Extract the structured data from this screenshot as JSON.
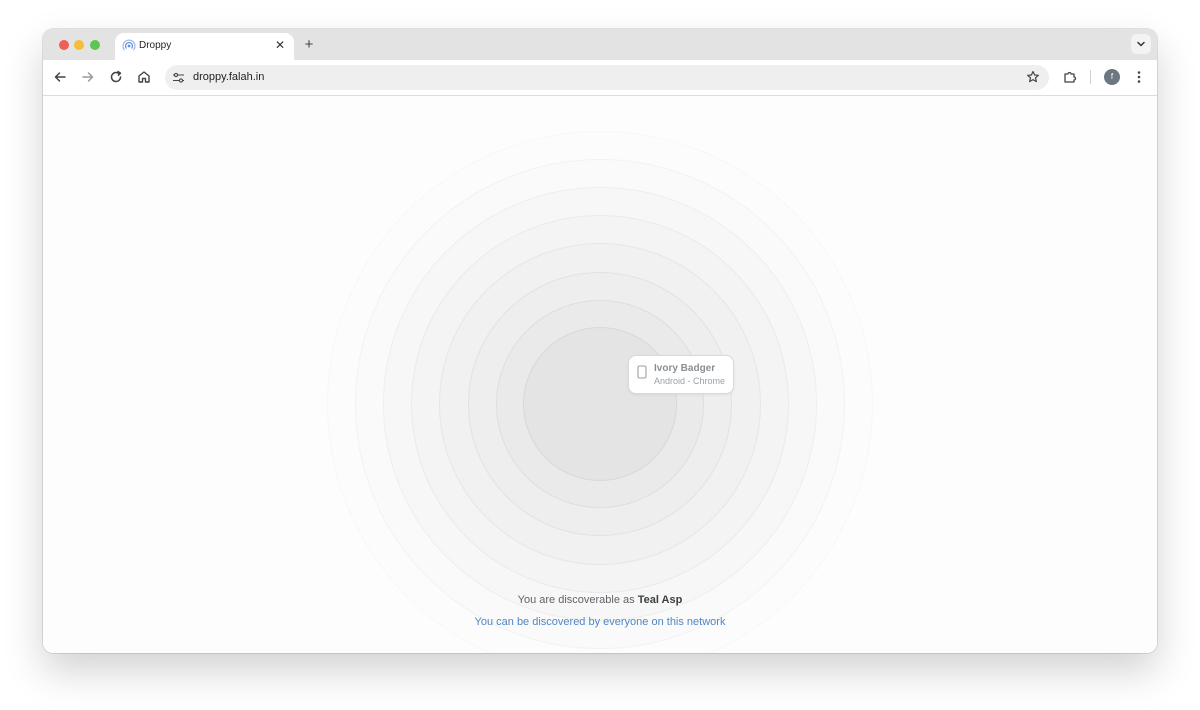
{
  "browser": {
    "tab": {
      "title": "Droppy",
      "close_glyph": "✕"
    },
    "new_tab_glyph": "+",
    "url": "droppy.falah.in",
    "profile_initial": "f"
  },
  "radar": {
    "peer": {
      "name": "Ivory Badger",
      "platform": "Android - Chrome",
      "icon": "phone-icon"
    }
  },
  "status": {
    "discoverable_prefix": "You are discoverable as",
    "device_name": "Teal Asp",
    "visibility_link": "You can be discovered by everyone on this network"
  },
  "colors": {
    "link": "#4f86c6",
    "tabstrip": "#e3e3e3"
  }
}
